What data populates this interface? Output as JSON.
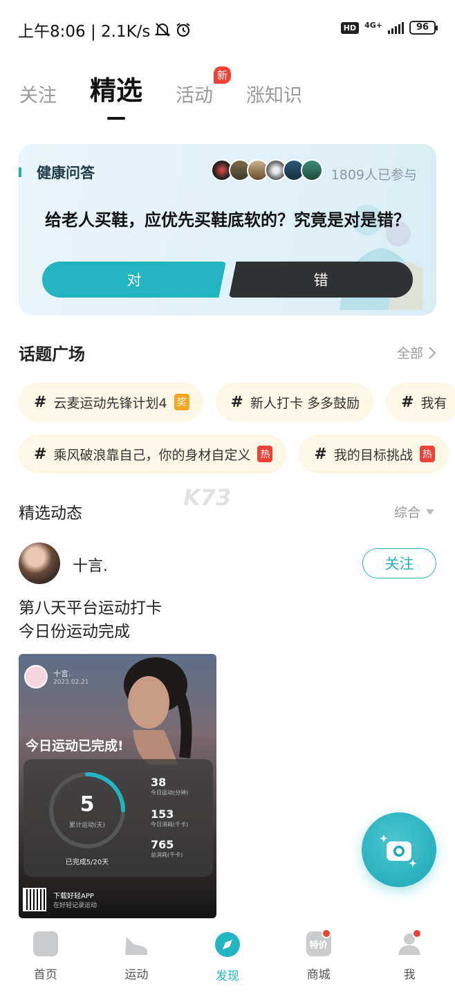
{
  "status_bar": {
    "time_speed": "上午8:06 | 2.1K/s",
    "hd": "HD",
    "network": "4G+",
    "battery": "96"
  },
  "tabs": [
    {
      "label": "关注"
    },
    {
      "label": "精选"
    },
    {
      "label": "活动",
      "badge": "新"
    },
    {
      "label": "涨知识"
    }
  ],
  "quiz": {
    "tag": "健康问答",
    "participants": "1809人已参与",
    "question": "给老人买鞋，应优先买鞋底软的？究竟是对是错？",
    "yes_label": "对",
    "no_label": "错"
  },
  "topics": {
    "title": "话题广场",
    "more_label": "全部",
    "row1": [
      {
        "text": "云麦运动先锋计划4",
        "tag": "奖",
        "tag_color": "#f5a623"
      },
      {
        "text": "新人打卡 多多鼓励",
        "tag": "",
        "tag_color": ""
      },
      {
        "text": "我有",
        "tag": "",
        "tag_color": ""
      }
    ],
    "row2": [
      {
        "text": "乘风破浪靠自己，你的身材自定义",
        "tag": "热",
        "tag_color": "#f04234"
      },
      {
        "text": "我的目标挑战",
        "tag": "热",
        "tag_color": "#f04234"
      }
    ]
  },
  "feed": {
    "title": "精选动态",
    "sort_label": "综合",
    "post": {
      "username": "十言.",
      "follow_label": "关注",
      "text_line1": "第八天平台运动打卡",
      "text_line2": "今日份运动完成",
      "card": {
        "user": "十言.",
        "date": "2023.02.21",
        "done_text": "今日运动已完成!",
        "count": "5",
        "count_label": "累计运动(天)",
        "progress_text": "已完成5/20天",
        "progress_fraction": 0.25,
        "stats": [
          {
            "value": "38",
            "label": "今日运动(分钟)"
          },
          {
            "value": "153",
            "label": "今日消耗(千卡)"
          },
          {
            "value": "765",
            "label": "总消耗(千卡)"
          }
        ],
        "footer_title": "下载好轻APP",
        "footer_sub": "在好轻记录运动"
      }
    }
  },
  "watermark": "K73",
  "nav": [
    {
      "label": "首页",
      "icon": "home-icon",
      "dot": false
    },
    {
      "label": "运动",
      "icon": "shoe-icon",
      "dot": false
    },
    {
      "label": "发现",
      "icon": "compass-icon",
      "dot": false
    },
    {
      "label": "商城",
      "icon": "shop-icon",
      "icon_text": "特价",
      "dot": true
    },
    {
      "label": "我",
      "icon": "profile-icon",
      "dot": true
    }
  ],
  "colors": {
    "accent": "#22b4c1",
    "badge_red": "#f04234",
    "chip_bg": "#fdf7e6"
  }
}
